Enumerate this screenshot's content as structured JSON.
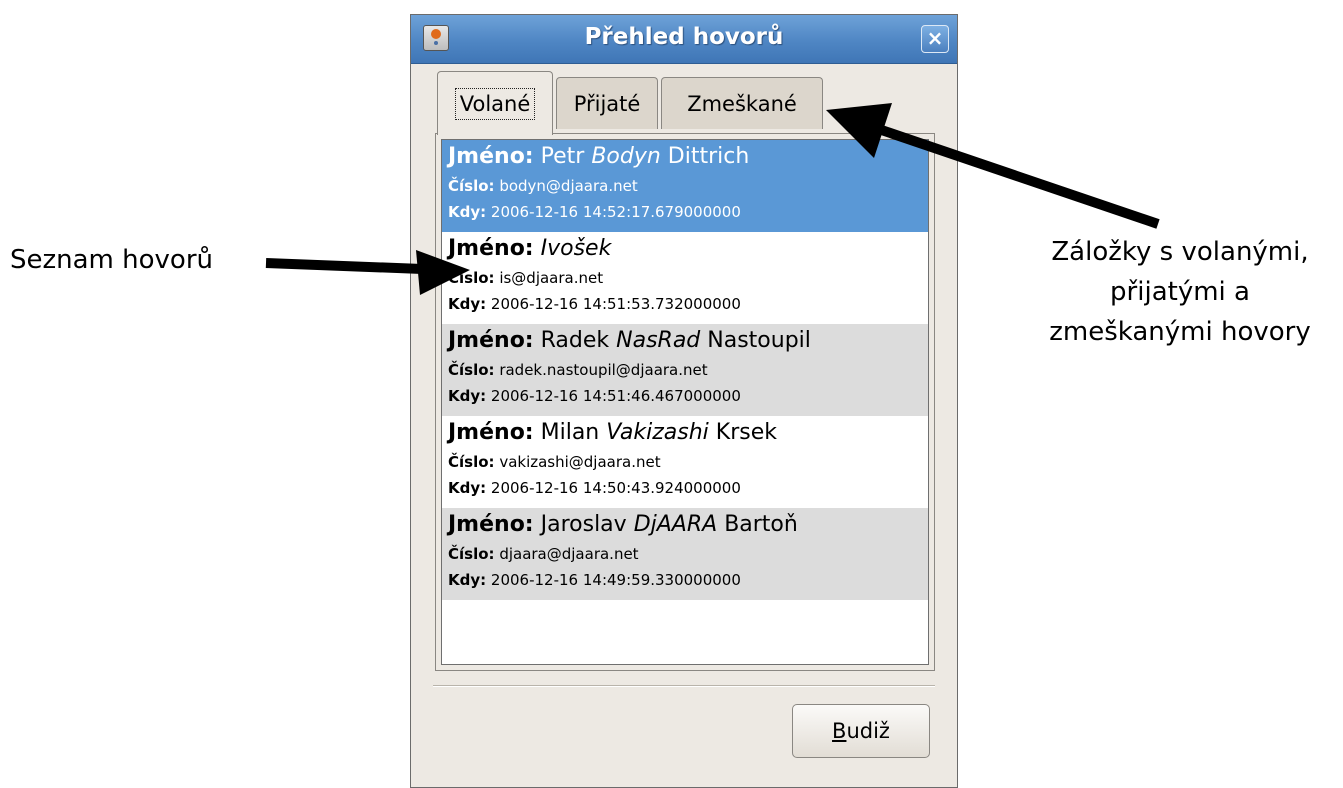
{
  "window": {
    "title": "Přehled hovorů",
    "close_glyph": "×",
    "icon": "java-app-icon"
  },
  "tabs": [
    {
      "label": "Volané",
      "active": true
    },
    {
      "label": "Přijaté",
      "active": false
    },
    {
      "label": "Zmeškané",
      "active": false
    }
  ],
  "labels": {
    "name": "Jméno:",
    "number": "Číslo:",
    "when": "Kdy:"
  },
  "calls": [
    {
      "first": "Petr",
      "nick": "Bodyn",
      "last": "Dittrich",
      "number": "bodyn@djaara.net",
      "when": "2006-12-16 14:52:17.679000000",
      "state": "selected"
    },
    {
      "first": "",
      "nick": "Ivošek",
      "last": "",
      "number": "is@djaara.net",
      "when": "2006-12-16 14:51:53.732000000",
      "state": "normal"
    },
    {
      "first": "Radek",
      "nick": "NasRad",
      "last": "Nastoupil",
      "number": "radek.nastoupil@djaara.net",
      "when": "2006-12-16 14:51:46.467000000",
      "state": "alt"
    },
    {
      "first": "Milan",
      "nick": "Vakizashi",
      "last": "Krsek",
      "number": "vakizashi@djaara.net",
      "when": "2006-12-16 14:50:43.924000000",
      "state": "normal"
    },
    {
      "first": "Jaroslav",
      "nick": "DjAARA",
      "last": "Bartoň",
      "number": "djaara@djaara.net",
      "when": "2006-12-16 14:49:59.330000000",
      "state": "alt"
    }
  ],
  "button": {
    "mnemonic": "B",
    "rest": "udiž"
  },
  "annotations": {
    "left": "Seznam hovorů",
    "right": [
      "Záložky s volanými,",
      "přijatými a",
      "zmeškanými hovory"
    ]
  },
  "colors": {
    "titlebar": "#4f86c4",
    "selection": "#5a98d6",
    "window_bg": "#ede9e3"
  }
}
